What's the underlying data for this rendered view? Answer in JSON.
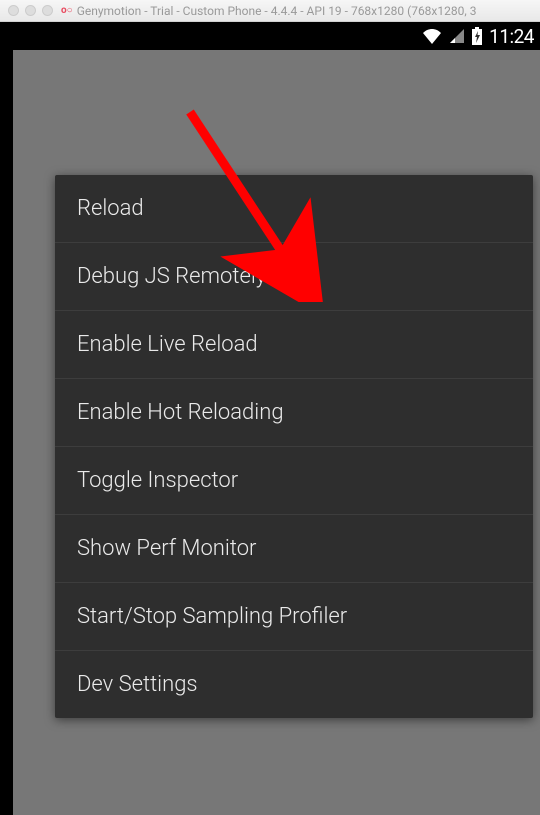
{
  "titlebar": {
    "text": "Genymotion - Trial - Custom Phone - 4.4.4 - API 19 - 768x1280 (768x1280, 3"
  },
  "statusbar": {
    "time": "11:24"
  },
  "menu": {
    "items": [
      {
        "label": "Reload"
      },
      {
        "label": "Debug JS Remotely"
      },
      {
        "label": "Enable Live Reload"
      },
      {
        "label": "Enable Hot Reloading"
      },
      {
        "label": "Toggle Inspector"
      },
      {
        "label": "Show Perf Monitor"
      },
      {
        "label": "Start/Stop Sampling Profiler"
      },
      {
        "label": "Dev Settings"
      }
    ]
  }
}
